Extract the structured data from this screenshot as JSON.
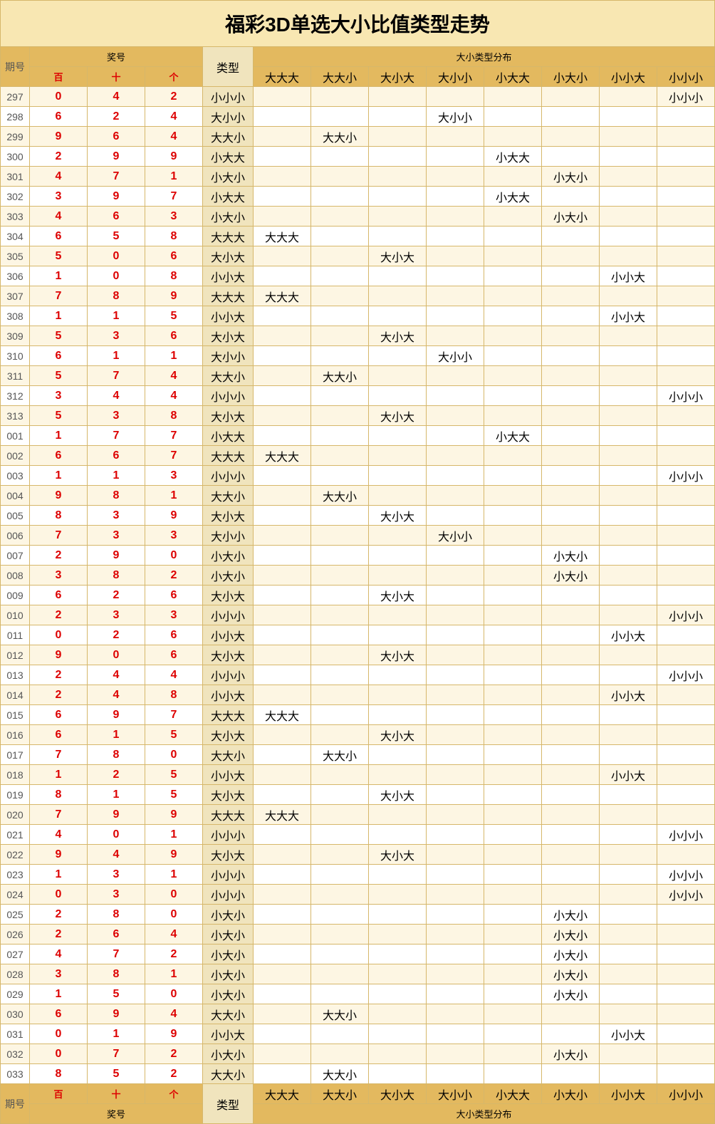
{
  "title": "福彩3D单选大小比值类型走势",
  "header": {
    "period": "期号",
    "prize": "奖号",
    "digit_bai": "百",
    "digit_shi": "十",
    "digit_ge": "个",
    "type": "类型",
    "dist": "大小类型分布",
    "types": [
      "大大大",
      "大大小",
      "大小大",
      "大小小",
      "小大大",
      "小大小",
      "小小大",
      "小小小"
    ]
  },
  "chart_data": {
    "type": "table",
    "title": "福彩3D单选大小比值类型走势",
    "columns": [
      "期号",
      "百",
      "十",
      "个",
      "类型"
    ],
    "rows": [
      {
        "p": "297",
        "d": [
          0,
          4,
          2
        ],
        "t": "小小小"
      },
      {
        "p": "298",
        "d": [
          6,
          2,
          4
        ],
        "t": "大小小"
      },
      {
        "p": "299",
        "d": [
          9,
          6,
          4
        ],
        "t": "大大小"
      },
      {
        "p": "300",
        "d": [
          2,
          9,
          9
        ],
        "t": "小大大"
      },
      {
        "p": "301",
        "d": [
          4,
          7,
          1
        ],
        "t": "小大小"
      },
      {
        "p": "302",
        "d": [
          3,
          9,
          7
        ],
        "t": "小大大"
      },
      {
        "p": "303",
        "d": [
          4,
          6,
          3
        ],
        "t": "小大小"
      },
      {
        "p": "304",
        "d": [
          6,
          5,
          8
        ],
        "t": "大大大"
      },
      {
        "p": "305",
        "d": [
          5,
          0,
          6
        ],
        "t": "大小大"
      },
      {
        "p": "306",
        "d": [
          1,
          0,
          8
        ],
        "t": "小小大"
      },
      {
        "p": "307",
        "d": [
          7,
          8,
          9
        ],
        "t": "大大大"
      },
      {
        "p": "308",
        "d": [
          1,
          1,
          5
        ],
        "t": "小小大"
      },
      {
        "p": "309",
        "d": [
          5,
          3,
          6
        ],
        "t": "大小大"
      },
      {
        "p": "310",
        "d": [
          6,
          1,
          1
        ],
        "t": "大小小"
      },
      {
        "p": "311",
        "d": [
          5,
          7,
          4
        ],
        "t": "大大小"
      },
      {
        "p": "312",
        "d": [
          3,
          4,
          4
        ],
        "t": "小小小"
      },
      {
        "p": "313",
        "d": [
          5,
          3,
          8
        ],
        "t": "大小大"
      },
      {
        "p": "001",
        "d": [
          1,
          7,
          7
        ],
        "t": "小大大"
      },
      {
        "p": "002",
        "d": [
          6,
          6,
          7
        ],
        "t": "大大大"
      },
      {
        "p": "003",
        "d": [
          1,
          1,
          3
        ],
        "t": "小小小"
      },
      {
        "p": "004",
        "d": [
          9,
          8,
          1
        ],
        "t": "大大小"
      },
      {
        "p": "005",
        "d": [
          8,
          3,
          9
        ],
        "t": "大小大"
      },
      {
        "p": "006",
        "d": [
          7,
          3,
          3
        ],
        "t": "大小小"
      },
      {
        "p": "007",
        "d": [
          2,
          9,
          0
        ],
        "t": "小大小"
      },
      {
        "p": "008",
        "d": [
          3,
          8,
          2
        ],
        "t": "小大小"
      },
      {
        "p": "009",
        "d": [
          6,
          2,
          6
        ],
        "t": "大小大"
      },
      {
        "p": "010",
        "d": [
          2,
          3,
          3
        ],
        "t": "小小小"
      },
      {
        "p": "011",
        "d": [
          0,
          2,
          6
        ],
        "t": "小小大"
      },
      {
        "p": "012",
        "d": [
          9,
          0,
          6
        ],
        "t": "大小大"
      },
      {
        "p": "013",
        "d": [
          2,
          4,
          4
        ],
        "t": "小小小"
      },
      {
        "p": "014",
        "d": [
          2,
          4,
          8
        ],
        "t": "小小大"
      },
      {
        "p": "015",
        "d": [
          6,
          9,
          7
        ],
        "t": "大大大"
      },
      {
        "p": "016",
        "d": [
          6,
          1,
          5
        ],
        "t": "大小大"
      },
      {
        "p": "017",
        "d": [
          7,
          8,
          0
        ],
        "t": "大大小"
      },
      {
        "p": "018",
        "d": [
          1,
          2,
          5
        ],
        "t": "小小大"
      },
      {
        "p": "019",
        "d": [
          8,
          1,
          5
        ],
        "t": "大小大"
      },
      {
        "p": "020",
        "d": [
          7,
          9,
          9
        ],
        "t": "大大大"
      },
      {
        "p": "021",
        "d": [
          4,
          0,
          1
        ],
        "t": "小小小"
      },
      {
        "p": "022",
        "d": [
          9,
          4,
          9
        ],
        "t": "大小大"
      },
      {
        "p": "023",
        "d": [
          1,
          3,
          1
        ],
        "t": "小小小"
      },
      {
        "p": "024",
        "d": [
          0,
          3,
          0
        ],
        "t": "小小小"
      },
      {
        "p": "025",
        "d": [
          2,
          8,
          0
        ],
        "t": "小大小"
      },
      {
        "p": "026",
        "d": [
          2,
          6,
          4
        ],
        "t": "小大小"
      },
      {
        "p": "027",
        "d": [
          4,
          7,
          2
        ],
        "t": "小大小"
      },
      {
        "p": "028",
        "d": [
          3,
          8,
          1
        ],
        "t": "小大小"
      },
      {
        "p": "029",
        "d": [
          1,
          5,
          0
        ],
        "t": "小大小"
      },
      {
        "p": "030",
        "d": [
          6,
          9,
          4
        ],
        "t": "大大小"
      },
      {
        "p": "031",
        "d": [
          0,
          1,
          9
        ],
        "t": "小小大"
      },
      {
        "p": "032",
        "d": [
          0,
          7,
          2
        ],
        "t": "小大小"
      },
      {
        "p": "033",
        "d": [
          8,
          5,
          2
        ],
        "t": "大大小"
      }
    ]
  }
}
